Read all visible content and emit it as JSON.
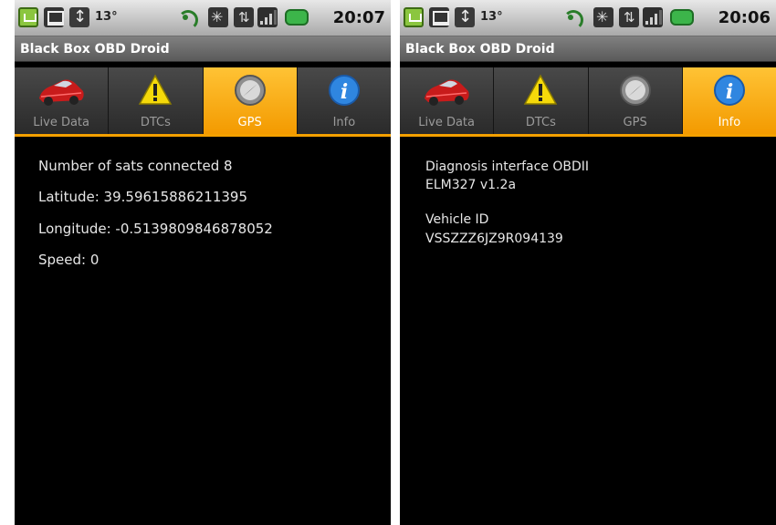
{
  "screens": [
    {
      "statusbar": {
        "temperature": "13°",
        "time": "20:07"
      },
      "app_title": "Black Box OBD Droid",
      "tabs": [
        {
          "label": "Live Data",
          "icon": "car-icon",
          "selected": false
        },
        {
          "label": "DTCs",
          "icon": "warning-icon",
          "selected": false
        },
        {
          "label": "GPS",
          "icon": "compass-icon",
          "selected": true
        },
        {
          "label": "Info",
          "icon": "info-icon",
          "selected": false
        }
      ],
      "gps": {
        "sats": "Number of sats connected 8",
        "latitude": "Latitude: 39.59615886211395",
        "longitude": "Longitude: -0.5139809846878052",
        "speed": "Speed: 0"
      }
    },
    {
      "statusbar": {
        "temperature": "13°",
        "time": "20:06"
      },
      "app_title": "Black Box OBD Droid",
      "tabs": [
        {
          "label": "Live Data",
          "icon": "car-icon",
          "selected": false
        },
        {
          "label": "DTCs",
          "icon": "warning-icon",
          "selected": false
        },
        {
          "label": "GPS",
          "icon": "compass-icon",
          "selected": false
        },
        {
          "label": "Info",
          "icon": "info-icon",
          "selected": true
        }
      ],
      "info": {
        "diag_label": "Diagnosis interface OBDII",
        "diag_value": "ELM327 v1.2a",
        "vehicle_label": "Vehicle ID",
        "vehicle_value": "VSSZZZ6JZ9R094139"
      }
    }
  ],
  "colors": {
    "tab_selected": "#f4a000",
    "titlebar": "#6b6b6b",
    "screen_bg": "#000000",
    "text": "#e7e7e7"
  }
}
